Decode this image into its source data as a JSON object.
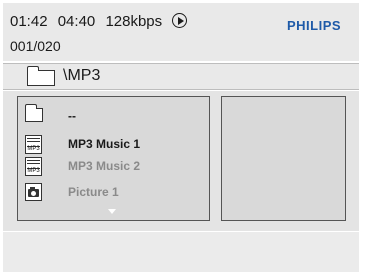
{
  "status": {
    "elapsed": "01:42",
    "total": "04:40",
    "bitrate": "128kbps",
    "play_state_icon": "play-circle-icon",
    "counter": "001/020"
  },
  "brand": {
    "name": "PHILIPS",
    "color": "#1e5aa8"
  },
  "path": {
    "folder_icon": "folder-icon",
    "current": "\\MP3"
  },
  "browser": {
    "items": [
      {
        "type": "folder",
        "icon": "folder-icon",
        "label": "--"
      },
      {
        "type": "mp3",
        "icon": "mp3-file-icon",
        "icon_tag": "MP3",
        "label": "MP3 Music 1"
      },
      {
        "type": "mp3",
        "icon": "mp3-file-icon",
        "icon_tag": "MP3",
        "label": "MP3 Music 2"
      },
      {
        "type": "picture",
        "icon": "camera-icon",
        "label": "Picture 1"
      }
    ],
    "scroll_indicator": "down-arrow-icon"
  }
}
